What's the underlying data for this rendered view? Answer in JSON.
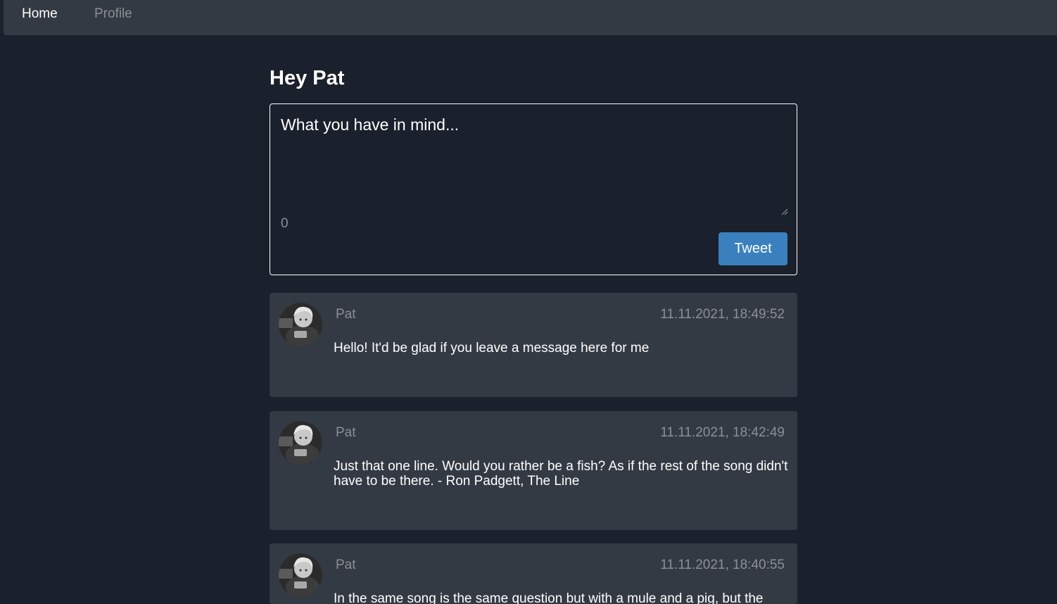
{
  "nav": {
    "home_label": "Home",
    "profile_label": "Profile"
  },
  "page": {
    "title": "Hey Pat"
  },
  "composer": {
    "placeholder": "What you have in mind...",
    "char_count": "0",
    "tweet_label": "Tweet"
  },
  "tweets": [
    {
      "author": "Pat",
      "timestamp": "11.11.2021, 18:49:52",
      "text": "Hello! It'd be glad if you leave a message here for me"
    },
    {
      "author": "Pat",
      "timestamp": "11.11.2021, 18:42:49",
      "text": "Just that one line. Would you rather be a fish? As if the rest of the song didn't have to be there. - Ron Padgett, The Line"
    },
    {
      "author": "Pat",
      "timestamp": "11.11.2021, 18:40:55",
      "text": "In the same song is the same question but with a mule and a pig, but the"
    }
  ],
  "colors": {
    "background": "#1a202c",
    "surface": "#343a44",
    "accent": "#3a80be",
    "muted_text": "#8b8f96"
  }
}
